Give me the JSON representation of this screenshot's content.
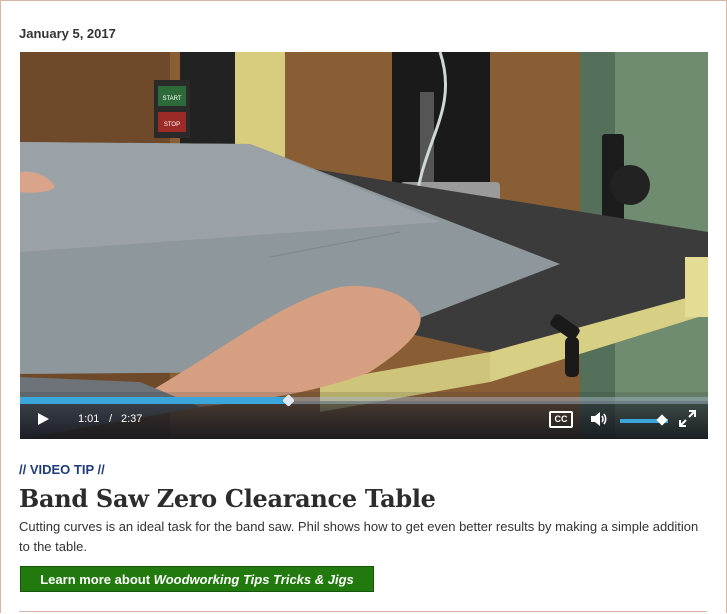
{
  "post": {
    "date": "January 5, 2017",
    "kicker": "// VIDEO TIP //",
    "title": "Band Saw Zero Clearance Table",
    "description": "Cutting curves is an ideal task for the band saw. Phil shows how to get even better results by making a simple addition to the table.",
    "cta_prefix": "Learn more about ",
    "cta_link": "Woodworking Tips Tricks & Jigs"
  },
  "video": {
    "current_time": "1:01",
    "separator": "/",
    "duration": "2:37",
    "progress": 0.39,
    "volume": 0.88,
    "cc_label": "CC",
    "machine_start_label": "START",
    "machine_stop_label": "STOP",
    "icons": [
      "play-icon",
      "closed-captions-icon",
      "volume-icon",
      "fullscreen-icon"
    ]
  },
  "colors": {
    "accent_blue": "#3aa6dc",
    "kicker_navy": "#1f3c7a",
    "cta_green": "#227a0e"
  }
}
